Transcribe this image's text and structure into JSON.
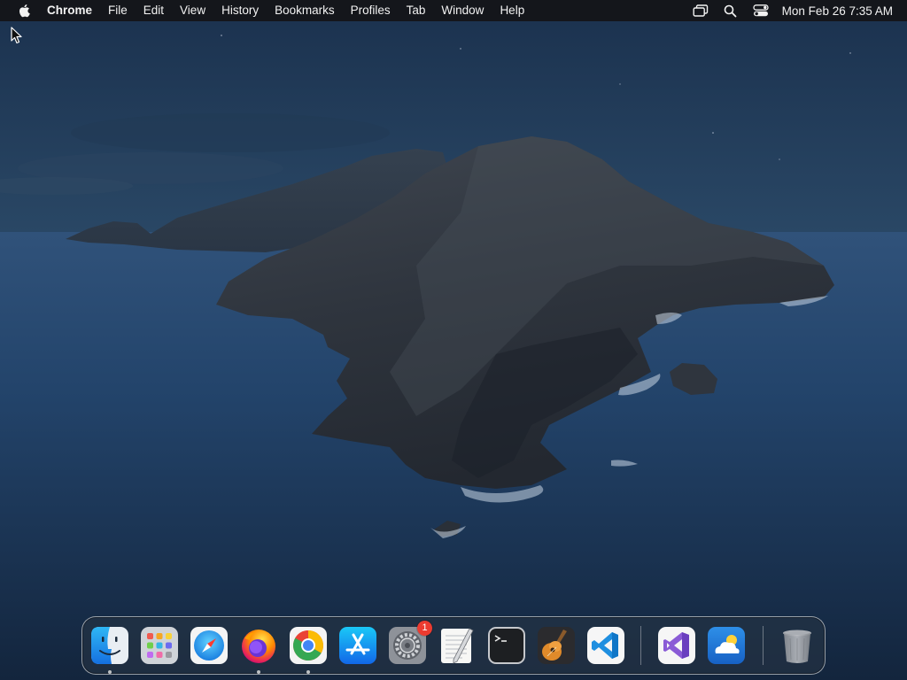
{
  "menubar": {
    "apple_icon": "apple-logo-icon",
    "app_name": "Chrome",
    "menus": [
      "File",
      "Edit",
      "View",
      "History",
      "Bookmarks",
      "Profiles",
      "Tab",
      "Window",
      "Help"
    ],
    "status_icons": [
      "screen-mirroring-icon",
      "spotlight-search-icon",
      "control-center-icon"
    ],
    "clock": "Mon Feb 26  7:35 AM"
  },
  "dock": {
    "apps": [
      {
        "name": "Finder",
        "icon": "finder-icon",
        "running": true
      },
      {
        "name": "Launchpad",
        "icon": "launchpad-icon",
        "running": false
      },
      {
        "name": "Safari",
        "icon": "safari-icon",
        "running": false
      },
      {
        "name": "Firefox",
        "icon": "firefox-icon",
        "running": true
      },
      {
        "name": "Google Chrome",
        "icon": "chrome-icon",
        "running": true
      },
      {
        "name": "App Store",
        "icon": "app-store-icon",
        "running": false
      },
      {
        "name": "System Preferences",
        "icon": "system-preferences-icon",
        "running": false,
        "badge": "1"
      },
      {
        "name": "TextEdit",
        "icon": "textedit-icon",
        "running": false
      },
      {
        "name": "Terminal",
        "icon": "terminal-icon",
        "running": false
      },
      {
        "name": "GarageBand",
        "icon": "garageband-icon",
        "running": false
      },
      {
        "name": "Visual Studio Code",
        "icon": "vscode-icon",
        "running": false
      }
    ],
    "recent_apps": [
      {
        "name": "Visual Studio",
        "icon": "visual-studio-icon"
      },
      {
        "name": "Weather",
        "icon": "weather-icon"
      }
    ],
    "trash": {
      "name": "Trash",
      "icon": "trash-icon"
    }
  },
  "colors": {
    "menubar_bg": "#14161b",
    "sky_top": "#1d3551",
    "sea": "#1f3c63",
    "badge": "#ec3b30"
  }
}
